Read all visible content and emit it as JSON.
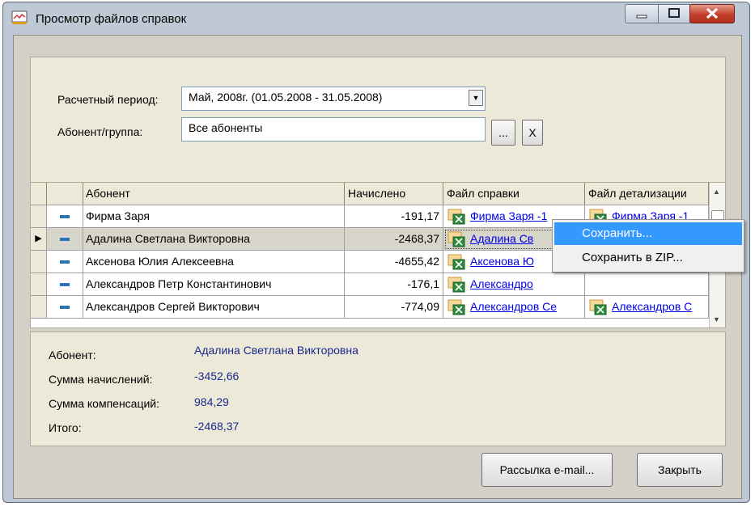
{
  "window": {
    "title": "Просмотр файлов справок"
  },
  "form": {
    "period_label": "Расчетный период:",
    "period_value": "Май, 2008г. (01.05.2008 - 31.05.2008)",
    "subscriber_label": "Абонент/группа:",
    "subscriber_value": "Все абоненты",
    "browse_label": "...",
    "clear_label": "X"
  },
  "grid": {
    "columns": [
      "Абонент",
      "Начислено",
      "Файл справки",
      "Файл детализации"
    ],
    "rows": [
      {
        "name": "Фирма Заря",
        "amount": "-191,17",
        "file": "Фирма Заря -1",
        "detail": "Фирма Заря -1"
      },
      {
        "name": "Адалина Светлана Викторовна",
        "amount": "-2468,37",
        "file": "Адалина Св",
        "detail": ""
      },
      {
        "name": "Аксенова Юлия Алексеевна",
        "amount": "-4655,42",
        "file": "Аксенова Ю",
        "detail": ""
      },
      {
        "name": "Александров Петр Константинович",
        "amount": "-176,1",
        "file": "Александро",
        "detail": ""
      },
      {
        "name": "Александров Сергей Викторович",
        "amount": "-774,09",
        "file": "Александров Се",
        "detail": "Александров С"
      }
    ]
  },
  "context_menu": {
    "items": [
      "Сохранить...",
      "Сохранить в ZIP..."
    ]
  },
  "info": {
    "subscriber_label": "Абонент:",
    "subscriber_value": "Адалина Светлана Викторовна",
    "charges_label": "Сумма начислений:",
    "charges_value": "-3452,66",
    "compensation_label": "Сумма компенсаций:",
    "compensation_value": "984,29",
    "total_label": "Итого:",
    "total_value": "-2468,37"
  },
  "buttons": {
    "email": "Рассылка e-mail...",
    "close": "Закрыть"
  }
}
